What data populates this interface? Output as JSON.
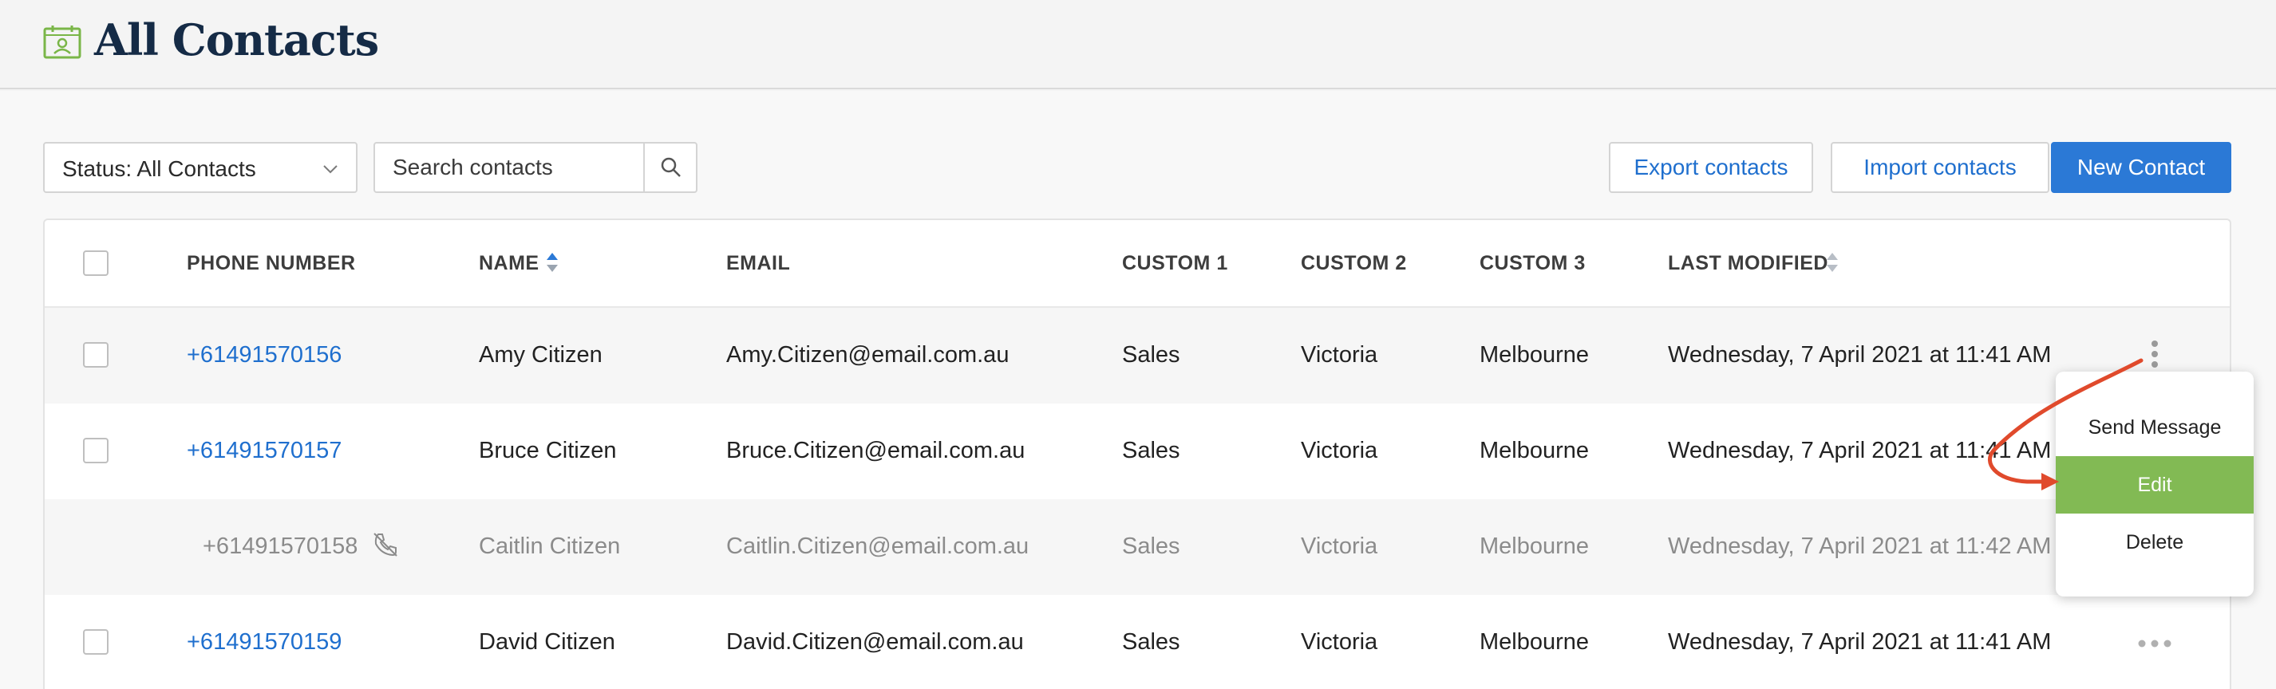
{
  "header": {
    "title": "All Contacts",
    "icon": "contacts-calendar-icon",
    "icon_color": "#7ab648"
  },
  "toolbar": {
    "status_filter": "Status: All Contacts",
    "search_placeholder": "Search contacts",
    "export_label": "Export contacts",
    "import_label": "Import contacts",
    "new_label": "New Contact"
  },
  "columns": {
    "phone": "PHONE NUMBER",
    "name": "NAME",
    "email": "EMAIL",
    "custom1": "CUSTOM 1",
    "custom2": "CUSTOM 2",
    "custom3": "CUSTOM 3",
    "last_modified": "LAST MODIFIED"
  },
  "rows": [
    {
      "phone": "+61491570156",
      "name": "Amy Citizen",
      "email": "Amy.Citizen@email.com.au",
      "custom1": "Sales",
      "custom2": "Victoria",
      "custom3": "Melbourne",
      "last_modified": "Wednesday, 7 April 2021 at 11:41 AM"
    },
    {
      "phone": "+61491570157",
      "name": "Bruce Citizen",
      "email": "Bruce.Citizen@email.com.au",
      "custom1": "Sales",
      "custom2": "Victoria",
      "custom3": "Melbourne",
      "last_modified": "Wednesday, 7 April 2021 at 11:41 AM"
    },
    {
      "phone": "+61491570158",
      "name": "Caitlin Citizen",
      "email": "Caitlin.Citizen@email.com.au",
      "custom1": "Sales",
      "custom2": "Victoria",
      "custom3": "Melbourne",
      "last_modified": "Wednesday, 7 April 2021 at 11:42 AM",
      "status": "opted-out"
    },
    {
      "phone": "+61491570159",
      "name": "David Citizen",
      "email": "David.Citizen@email.com.au",
      "custom1": "Sales",
      "custom2": "Victoria",
      "custom3": "Melbourne",
      "last_modified": "Wednesday, 7 April 2021 at 11:41 AM"
    }
  ],
  "row_menu": {
    "items": [
      "Send Message",
      "Edit",
      "Delete"
    ],
    "highlighted": "Edit"
  },
  "colors": {
    "link": "#1f6fce",
    "primary_button": "#2b79d6",
    "menu_highlight": "#82ba54",
    "annotation_arrow": "#e04a2c"
  }
}
